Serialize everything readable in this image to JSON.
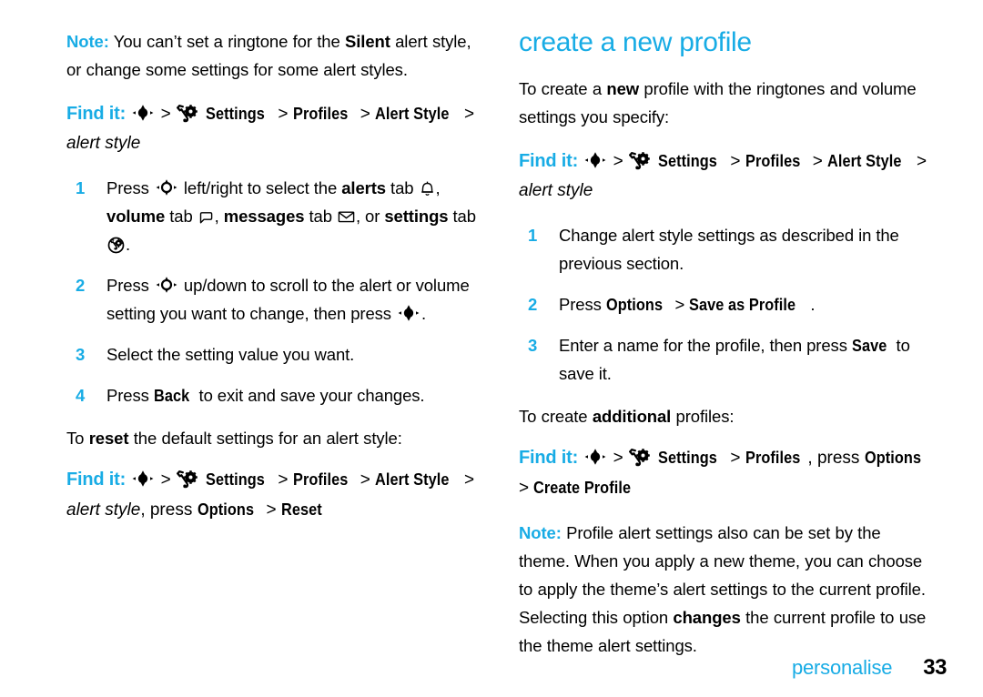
{
  "accent_color": "#18ace5",
  "left_column": {
    "note": {
      "label": "Note:",
      "text_part1": " You can’t set a ringtone for the ",
      "bold1": "Silent",
      "text_part2": " alert style, or change some settings for some alert styles."
    },
    "find_it_1": {
      "label": "Find it:",
      "sep": ">",
      "settings": "Settings",
      "profiles": "Profiles",
      "alert_style": "Alert Style",
      "italic_tail": "alert style"
    },
    "steps": [
      {
        "num": "1",
        "t1": "Press ",
        "t2": " left/right to select the ",
        "b1": "alerts",
        "t3": " tab ",
        "t4": ", ",
        "b2": "volume",
        "t5": " tab ",
        "t6": ", ",
        "b3": "messages",
        "t7": " tab ",
        "t8": ", or ",
        "b4": "settings",
        "t9": " tab ",
        "t10": "."
      },
      {
        "num": "2",
        "t1": "Press ",
        "t2": " up/down to scroll to the alert or volume setting you want to change, then press ",
        "t3": "."
      },
      {
        "num": "3",
        "t1": "Select the setting value you want."
      },
      {
        "num": "4",
        "t1": "Press ",
        "b1": "Back",
        "t2": " to exit and save your changes."
      }
    ],
    "reset_intro": {
      "t1": "To ",
      "b1": "reset",
      "t2": " the default settings for an alert style:"
    },
    "find_it_2": {
      "label": "Find it:",
      "sep": ">",
      "settings": "Settings",
      "profiles": "Profiles",
      "alert_style": "Alert Style",
      "italic_tail": "alert style",
      "tail_text": ", press ",
      "options": "Options",
      "reset": "Reset"
    }
  },
  "right_column": {
    "heading": "create a new profile",
    "intro": {
      "t1": "To create a ",
      "b1": "new",
      "t2": " profile with the ringtones and volume settings you specify:"
    },
    "find_it_1": {
      "label": "Find it:",
      "sep": ">",
      "settings": "Settings",
      "profiles": "Profiles",
      "alert_style": "Alert Style",
      "italic_tail": "alert style"
    },
    "steps": [
      {
        "num": "1",
        "t1": "Change alert style settings as described in the previous section."
      },
      {
        "num": "2",
        "t1": "Press ",
        "b1": "Options",
        "t2": " > ",
        "b2": "Save as Profile",
        "t3": "."
      },
      {
        "num": "3",
        "t1": "Enter a name for the profile, then press ",
        "b1": "Save",
        "t2": " to save it."
      }
    ],
    "additional_intro": {
      "t1": "To create ",
      "b1": "additional",
      "t2": " profiles:"
    },
    "find_it_2": {
      "label": "Find it:",
      "sep": ">",
      "settings": "Settings",
      "profiles": "Profiles",
      "tail_text": ", press ",
      "options": "Options",
      "sep2": "> ",
      "create_profile": "Create Profile"
    },
    "note": {
      "label": "Note:",
      "t1": " Profile alert settings also can be set by the theme. When you apply a new theme, you can choose to apply the theme’s alert settings to the current profile. Selecting this option ",
      "b1": "changes",
      "t2": " the current profile to use the theme alert settings."
    }
  },
  "footer": {
    "section": "personalise",
    "page_number": "33"
  },
  "icons": {
    "nav_key_select": "nav-key-select-icon",
    "nav_key_scroll": "nav-key-scroll-icon",
    "settings_gear": "settings-wrench-gear-icon",
    "alerts_tab": "bell-icon",
    "volume_tab": "speaker-horn-icon",
    "messages_tab": "envelope-icon",
    "settings_tab": "settings-circle-icon"
  }
}
